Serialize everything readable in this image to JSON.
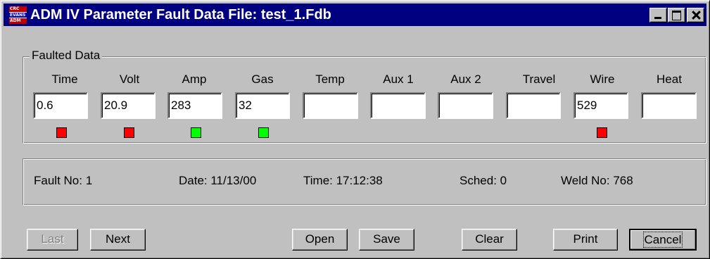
{
  "window": {
    "title": "ADM IV Parameter Fault Data File: test_1.Fdb",
    "icon_text": [
      "CRC",
      "EVANS",
      "ADM"
    ]
  },
  "faulted_data": {
    "group_label": "Faulted Data",
    "fields": [
      {
        "label": "Time",
        "value": "0.6",
        "status": "red"
      },
      {
        "label": "Volt",
        "value": "20.9",
        "status": "red"
      },
      {
        "label": "Amp",
        "value": "283",
        "status": "green"
      },
      {
        "label": "Gas",
        "value": "32",
        "status": "green"
      },
      {
        "label": "Temp",
        "value": "",
        "status": ""
      },
      {
        "label": "Aux 1",
        "value": "",
        "status": ""
      },
      {
        "label": "Aux 2",
        "value": "",
        "status": ""
      },
      {
        "label": "Travel",
        "value": "",
        "status": ""
      },
      {
        "label": "Wire",
        "value": "529",
        "status": "red"
      },
      {
        "label": "Heat",
        "value": "",
        "status": ""
      }
    ]
  },
  "info": {
    "fault_no": "Fault No: 1",
    "date": "Date: 11/13/00",
    "time": "Time: 17:12:38",
    "sched": "Sched: 0",
    "weld_no": "Weld No: 768"
  },
  "buttons": {
    "last": "Last",
    "next": "Next",
    "open": "Open",
    "save": "Save",
    "clear": "Clear",
    "print": "Print",
    "cancel": "Cancel"
  },
  "colors": {
    "titlebar": "#000080",
    "led_red": "#ff0000",
    "led_green": "#00ff00",
    "face": "#c0c0c0"
  }
}
